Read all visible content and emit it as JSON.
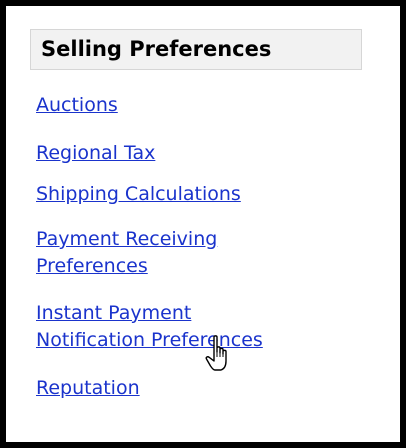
{
  "panel": {
    "title": "Selling Preferences",
    "links": [
      {
        "line1": "Auctions"
      },
      {
        "line1": "Regional Tax"
      },
      {
        "line1": "Shipping Calculations"
      },
      {
        "line1": "Payment Receiving",
        "line2": "Preferences"
      },
      {
        "line1": "Instant Payment",
        "line2": "Notification Preferences"
      },
      {
        "line1": "Reputation"
      }
    ]
  },
  "colors": {
    "link": "#1a33cc",
    "header_bg": "#f2f2f2",
    "border": "#000000"
  },
  "icons": {
    "cursor": "hand-pointer-icon"
  }
}
